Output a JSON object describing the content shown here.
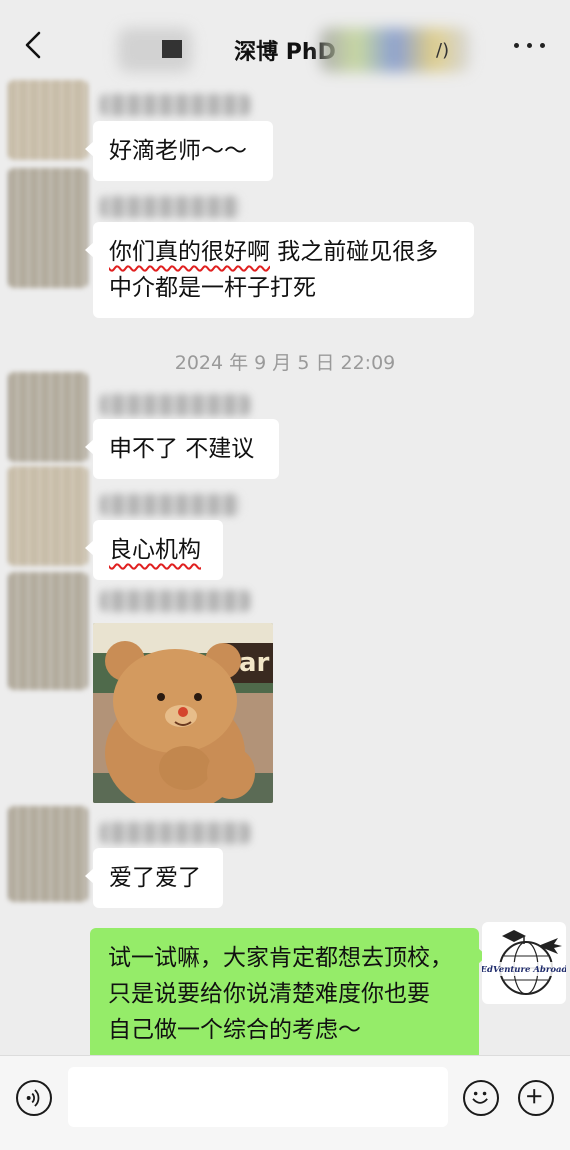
{
  "header": {
    "title": "深博 PhD",
    "title_suffix": "/)",
    "back_icon": "chevron-left-icon",
    "more_icon": "more-dots-icon"
  },
  "messages": [
    {
      "sender": "other",
      "text": "好滴老师～～"
    },
    {
      "sender": "other",
      "text_underlined": "你们真的很好啊",
      "text_rest": " 我之前碰见很多",
      "text_line2": "中介都是一杆子打死"
    },
    {
      "sender": "other",
      "text": "申不了 不建议"
    },
    {
      "sender": "other",
      "text_underlined": "良心机构"
    },
    {
      "sender": "other",
      "type": "sticker",
      "sticker_text": "ar"
    },
    {
      "sender": "other",
      "text": "爱了爱了"
    },
    {
      "sender": "me",
      "line1": "试一试嘛，大家肯定都想去顶校，",
      "line2": "只是说要给你说清楚难度你也要",
      "line3": "自己做一个综合的考虑～"
    }
  ],
  "timestamp": "2024 年 9 月 5 日 22:09",
  "my_avatar": {
    "logo_text": "EdVenture Abroad"
  },
  "input_bar": {
    "voice_icon": "voice-icon",
    "emoji_icon": "emoji-icon",
    "plus_icon": "plus-icon",
    "input_value": ""
  },
  "colors": {
    "background": "#ededed",
    "my_bubble": "#95ec69",
    "other_bubble": "#ffffff",
    "underline": "#e02020"
  }
}
